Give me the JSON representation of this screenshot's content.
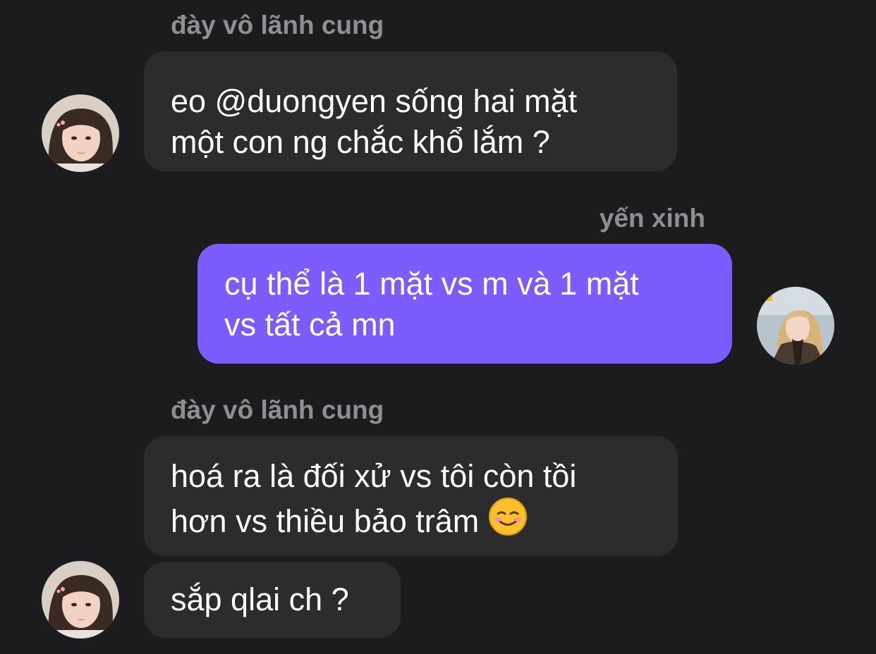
{
  "conversation": {
    "group1": {
      "sender_name": "đày vô lãnh cung",
      "message1": {
        "line1": "eo @duongyen sống hai mặt",
        "line2": "một con ng chắc khổ lắm ?"
      }
    },
    "group2": {
      "sender_name": "yến xinh",
      "message1": {
        "line1": "cụ thể là 1 mặt vs m và 1 mặt",
        "line2": "vs tất cả mn"
      }
    },
    "group3": {
      "sender_name": "đày vô lãnh cung",
      "message1": {
        "line1": "hoá ra là đối xử vs tôi còn tồi",
        "line2": "hơn vs thiều bảo trâm"
      },
      "message2": {
        "line1": "sắp qlai ch ?"
      }
    }
  },
  "colors": {
    "background": "#1c1c1e",
    "incoming_bubble": "#2c2c2e",
    "outgoing_bubble": "#7c5cfc",
    "sender_name": "#8e8e93",
    "message_text": "#ffffff"
  },
  "icons": {
    "reaction_emoji": "smiling-face-emoji"
  }
}
